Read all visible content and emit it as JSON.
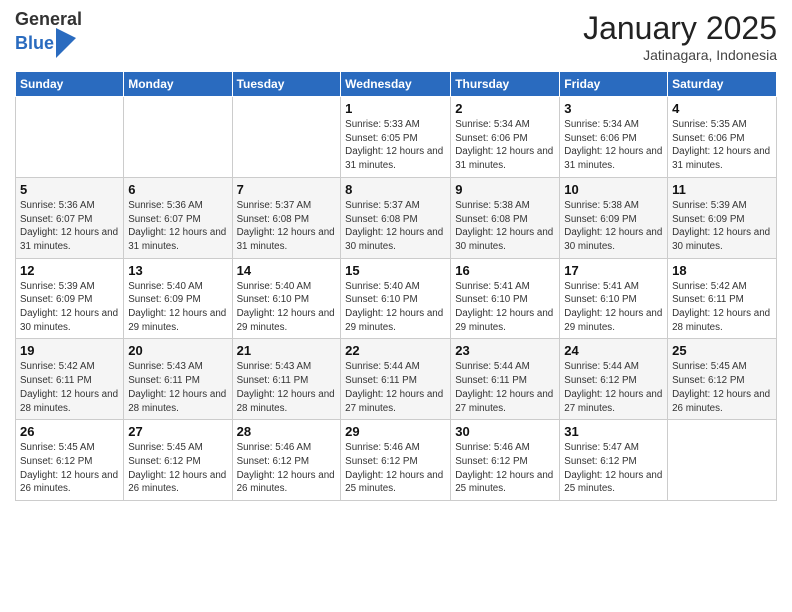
{
  "header": {
    "logo_general": "General",
    "logo_blue": "Blue",
    "month_title": "January 2025",
    "subtitle": "Jatinagara, Indonesia"
  },
  "weekdays": [
    "Sunday",
    "Monday",
    "Tuesday",
    "Wednesday",
    "Thursday",
    "Friday",
    "Saturday"
  ],
  "weeks": [
    [
      {
        "day": "",
        "info": ""
      },
      {
        "day": "",
        "info": ""
      },
      {
        "day": "",
        "info": ""
      },
      {
        "day": "1",
        "info": "Sunrise: 5:33 AM\nSunset: 6:05 PM\nDaylight: 12 hours\nand 31 minutes."
      },
      {
        "day": "2",
        "info": "Sunrise: 5:34 AM\nSunset: 6:06 PM\nDaylight: 12 hours\nand 31 minutes."
      },
      {
        "day": "3",
        "info": "Sunrise: 5:34 AM\nSunset: 6:06 PM\nDaylight: 12 hours\nand 31 minutes."
      },
      {
        "day": "4",
        "info": "Sunrise: 5:35 AM\nSunset: 6:06 PM\nDaylight: 12 hours\nand 31 minutes."
      }
    ],
    [
      {
        "day": "5",
        "info": "Sunrise: 5:36 AM\nSunset: 6:07 PM\nDaylight: 12 hours\nand 31 minutes."
      },
      {
        "day": "6",
        "info": "Sunrise: 5:36 AM\nSunset: 6:07 PM\nDaylight: 12 hours\nand 31 minutes."
      },
      {
        "day": "7",
        "info": "Sunrise: 5:37 AM\nSunset: 6:08 PM\nDaylight: 12 hours\nand 31 minutes."
      },
      {
        "day": "8",
        "info": "Sunrise: 5:37 AM\nSunset: 6:08 PM\nDaylight: 12 hours\nand 30 minutes."
      },
      {
        "day": "9",
        "info": "Sunrise: 5:38 AM\nSunset: 6:08 PM\nDaylight: 12 hours\nand 30 minutes."
      },
      {
        "day": "10",
        "info": "Sunrise: 5:38 AM\nSunset: 6:09 PM\nDaylight: 12 hours\nand 30 minutes."
      },
      {
        "day": "11",
        "info": "Sunrise: 5:39 AM\nSunset: 6:09 PM\nDaylight: 12 hours\nand 30 minutes."
      }
    ],
    [
      {
        "day": "12",
        "info": "Sunrise: 5:39 AM\nSunset: 6:09 PM\nDaylight: 12 hours\nand 30 minutes."
      },
      {
        "day": "13",
        "info": "Sunrise: 5:40 AM\nSunset: 6:09 PM\nDaylight: 12 hours\nand 29 minutes."
      },
      {
        "day": "14",
        "info": "Sunrise: 5:40 AM\nSunset: 6:10 PM\nDaylight: 12 hours\nand 29 minutes."
      },
      {
        "day": "15",
        "info": "Sunrise: 5:40 AM\nSunset: 6:10 PM\nDaylight: 12 hours\nand 29 minutes."
      },
      {
        "day": "16",
        "info": "Sunrise: 5:41 AM\nSunset: 6:10 PM\nDaylight: 12 hours\nand 29 minutes."
      },
      {
        "day": "17",
        "info": "Sunrise: 5:41 AM\nSunset: 6:10 PM\nDaylight: 12 hours\nand 29 minutes."
      },
      {
        "day": "18",
        "info": "Sunrise: 5:42 AM\nSunset: 6:11 PM\nDaylight: 12 hours\nand 28 minutes."
      }
    ],
    [
      {
        "day": "19",
        "info": "Sunrise: 5:42 AM\nSunset: 6:11 PM\nDaylight: 12 hours\nand 28 minutes."
      },
      {
        "day": "20",
        "info": "Sunrise: 5:43 AM\nSunset: 6:11 PM\nDaylight: 12 hours\nand 28 minutes."
      },
      {
        "day": "21",
        "info": "Sunrise: 5:43 AM\nSunset: 6:11 PM\nDaylight: 12 hours\nand 28 minutes."
      },
      {
        "day": "22",
        "info": "Sunrise: 5:44 AM\nSunset: 6:11 PM\nDaylight: 12 hours\nand 27 minutes."
      },
      {
        "day": "23",
        "info": "Sunrise: 5:44 AM\nSunset: 6:11 PM\nDaylight: 12 hours\nand 27 minutes."
      },
      {
        "day": "24",
        "info": "Sunrise: 5:44 AM\nSunset: 6:12 PM\nDaylight: 12 hours\nand 27 minutes."
      },
      {
        "day": "25",
        "info": "Sunrise: 5:45 AM\nSunset: 6:12 PM\nDaylight: 12 hours\nand 26 minutes."
      }
    ],
    [
      {
        "day": "26",
        "info": "Sunrise: 5:45 AM\nSunset: 6:12 PM\nDaylight: 12 hours\nand 26 minutes."
      },
      {
        "day": "27",
        "info": "Sunrise: 5:45 AM\nSunset: 6:12 PM\nDaylight: 12 hours\nand 26 minutes."
      },
      {
        "day": "28",
        "info": "Sunrise: 5:46 AM\nSunset: 6:12 PM\nDaylight: 12 hours\nand 26 minutes."
      },
      {
        "day": "29",
        "info": "Sunrise: 5:46 AM\nSunset: 6:12 PM\nDaylight: 12 hours\nand 25 minutes."
      },
      {
        "day": "30",
        "info": "Sunrise: 5:46 AM\nSunset: 6:12 PM\nDaylight: 12 hours\nand 25 minutes."
      },
      {
        "day": "31",
        "info": "Sunrise: 5:47 AM\nSunset: 6:12 PM\nDaylight: 12 hours\nand 25 minutes."
      },
      {
        "day": "",
        "info": ""
      }
    ]
  ]
}
